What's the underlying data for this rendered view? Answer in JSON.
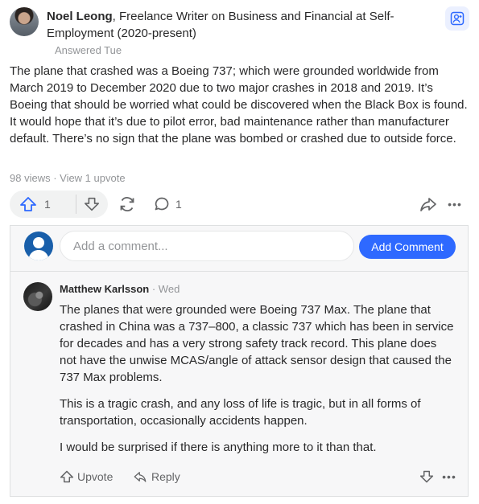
{
  "answer": {
    "author_name": "Noel Leong",
    "author_credential": ", Freelance Writer on Business and Financial at Self-Employment (2020-present)",
    "answered_label": "Answered Tue",
    "text": "The plane that crashed was a Boeing 737; which were grounded worldwide from March 2019 to December 2020 due to two major crashes in 2018 and 2019. It’s Boeing that should be worried what could be discovered when the Black Box is found. It would hope that it’s due to pilot error, bad maintenance rather than manufacturer default. There’s no sign that the plane was bombed or crashed due to outside force.",
    "meta": "98 views · View 1 upvote",
    "upvote_count": "1",
    "comment_count": "1"
  },
  "comment_box": {
    "placeholder": "Add a comment...",
    "button_label": "Add Comment"
  },
  "comment": {
    "author_name": "Matthew Karlsson",
    "date": " · Wed",
    "paragraphs": [
      "The planes that were grounded were Boeing 737 Max. The plane that crashed in China was a 737–800, a classic 737 which has been in service for decades and has a very strong safety track record. This plane does not have the unwise MCAS/angle of attack sensor design that caused the 737 Max problems.",
      "This is a tragic crash, and any loss of life is tragic, but in all forms of transportation, occasionally accidents happen.",
      "I would be surprised if there is anything more to it than that."
    ],
    "upvote_label": "Upvote",
    "reply_label": "Reply"
  },
  "icons": {
    "upvote": "upvote-arrow-icon",
    "downvote": "downvote-arrow-icon",
    "share": "share-cycle-icon",
    "comment": "comment-bubble-icon",
    "forward": "forward-arrow-icon",
    "more": "more-dots-icon",
    "follow": "follow-user-icon"
  },
  "colors": {
    "accent": "#2e69ff",
    "upvote_active": "#2e69ff",
    "text": "#282829",
    "muted": "#939598"
  }
}
